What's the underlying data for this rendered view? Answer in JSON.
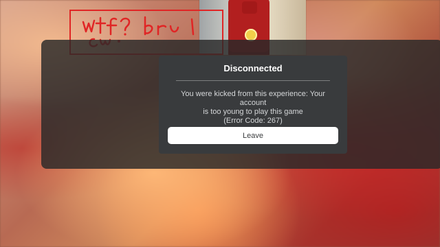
{
  "dialog": {
    "title": "Disconnected",
    "message_line1": "You were kicked from this experience: Your account",
    "message_line2": "is too young to play this game",
    "message_line3": "(Error Code: 267)",
    "leave_label": "Leave"
  },
  "annotation": {
    "color": "#e02525"
  }
}
